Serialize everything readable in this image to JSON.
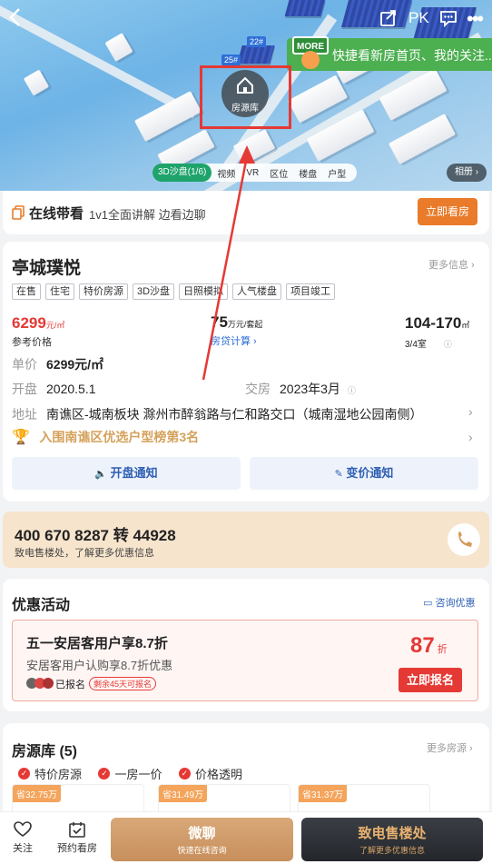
{
  "hero": {
    "more_badge": "MORE",
    "more_text": "快捷看新房首页、我的关注...",
    "house_badge_label": "房源库",
    "building_tags": [
      "22#",
      "25#"
    ],
    "tabs": [
      "3D沙盘(1/6)",
      "视频",
      "VR",
      "区位",
      "楼盘",
      "户型"
    ],
    "album_label": "相册",
    "pk_label": "PK"
  },
  "live": {
    "title": "在线带看",
    "subtitle": "1v1全面讲解 边看边聊",
    "button": "立即看房"
  },
  "property": {
    "name": "亭城璞悦",
    "more_info": "更多信息",
    "tags": [
      "在售",
      "住宅",
      "特价房源",
      "3D沙盘",
      "日照模拟",
      "人气楼盘",
      "项目竣工"
    ],
    "price_value": "6299",
    "price_unit": "元/㎡",
    "price_label": "参考价格",
    "total_value": "75",
    "total_unit": "万元/套起",
    "loan_calc": "房贷计算",
    "area_value": "104-170",
    "area_unit": "㎡",
    "room_types": "3/4室",
    "unit_price_key": "单价",
    "unit_price_val": "6299元/㎡",
    "open_key": "开盘",
    "open_val": "2020.5.1",
    "deliver_key": "交房",
    "deliver_val": "2023年3月",
    "address_key": "地址",
    "address_val": "南谯区-城南板块 滁州市醉翁路与仁和路交口（城南湿地公园南侧）",
    "ranking": "入围南谯区优选户型榜第3名",
    "notify_open": "开盘通知",
    "notify_price": "变价通知"
  },
  "phone": {
    "number": "400 670 8287 转 44928",
    "desc": "致电售楼处，了解更多优惠信息"
  },
  "promo": {
    "section_title": "优惠活动",
    "consult": "咨询优惠",
    "title": "五一安居客用户享8.7折",
    "desc": "安居客用户认购享8.7折优惠",
    "signed": "已报名",
    "remaining": "剩余45天可报名",
    "discount_value": "87",
    "discount_unit": "折",
    "signup_button": "立即报名"
  },
  "units": {
    "section_title": "房源库 (5)",
    "more": "更多房源",
    "features": [
      "特价房源",
      "一房一价",
      "价格透明"
    ],
    "savings": [
      "省32.75万",
      "省31.49万",
      "省31.37万"
    ]
  },
  "bottom": {
    "follow": "关注",
    "appointment": "预约看房",
    "wechat_title": "微聊",
    "wechat_sub": "快速在线咨询",
    "call_title": "致电售楼处",
    "call_sub": "了解更多优惠信息"
  }
}
